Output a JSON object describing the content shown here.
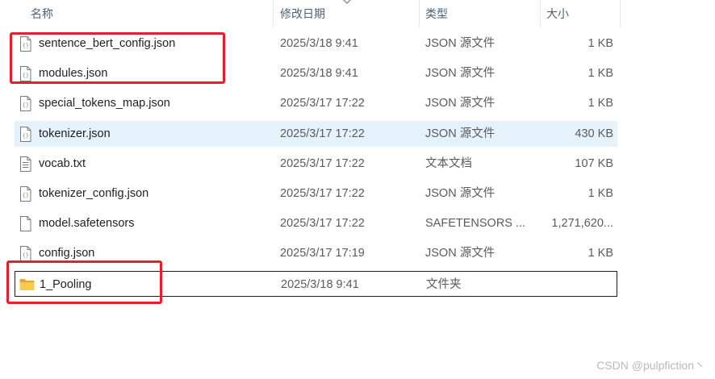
{
  "header": {
    "col_name": "名称",
    "col_date": "修改日期",
    "col_type": "类型",
    "col_size": "大小"
  },
  "files": [
    {
      "name": "sentence_bert_config.json",
      "date": "2025/3/18 9:41",
      "type": "JSON 源文件",
      "size": "1 KB",
      "icon": "json-file-icon"
    },
    {
      "name": "modules.json",
      "date": "2025/3/18 9:41",
      "type": "JSON 源文件",
      "size": "1 KB",
      "icon": "json-file-icon"
    },
    {
      "name": "special_tokens_map.json",
      "date": "2025/3/17 17:22",
      "type": "JSON 源文件",
      "size": "1 KB",
      "icon": "json-file-icon"
    },
    {
      "name": "tokenizer.json",
      "date": "2025/3/17 17:22",
      "type": "JSON 源文件",
      "size": "430 KB",
      "icon": "json-file-icon"
    },
    {
      "name": "vocab.txt",
      "date": "2025/3/17 17:22",
      "type": "文本文档",
      "size": "107 KB",
      "icon": "text-file-icon"
    },
    {
      "name": "tokenizer_config.json",
      "date": "2025/3/17 17:22",
      "type": "JSON 源文件",
      "size": "1 KB",
      "icon": "json-file-icon"
    },
    {
      "name": "model.safetensors",
      "date": "2025/3/17 17:22",
      "type": "SAFETENSORS ...",
      "size": "1,271,620...",
      "icon": "generic-file-icon"
    },
    {
      "name": "config.json",
      "date": "2025/3/17 17:19",
      "type": "JSON 源文件",
      "size": "1 KB",
      "icon": "json-file-icon"
    },
    {
      "name": "1_Pooling",
      "date": "2025/3/18 9:41",
      "type": "文件夹",
      "size": "",
      "icon": "folder-icon"
    }
  ],
  "colors": {
    "annotation_red": "#e5202a",
    "hover_row": "#e5f1fb",
    "folder_yellow": "#f8c94a"
  },
  "watermark": "CSDN @pulpfiction丶"
}
